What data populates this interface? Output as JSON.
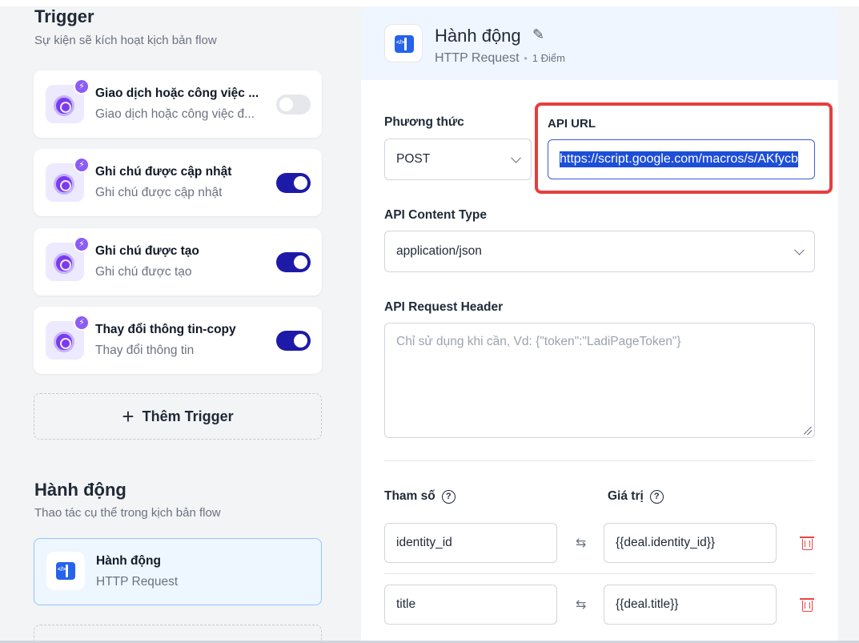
{
  "trigger_section": {
    "title": "Trigger",
    "subtitle": "Sự kiện sẽ kích hoạt kịch bản flow",
    "items": [
      {
        "title": "Giao dịch hoặc công việc ...",
        "subtitle": "Giao dịch hoặc công việc đ...",
        "enabled": false
      },
      {
        "title": "Ghi chú được cập nhật",
        "subtitle": "Ghi chú được cập nhật",
        "enabled": true
      },
      {
        "title": "Ghi chú được tạo",
        "subtitle": "Ghi chú được tạo",
        "enabled": true
      },
      {
        "title": "Thay đổi thông tin-copy",
        "subtitle": "Thay đổi thông tin",
        "enabled": true
      }
    ],
    "add_label": "Thêm Trigger"
  },
  "action_section": {
    "title": "Hành động",
    "subtitle": "Thao tác cụ thể trong kịch bản flow",
    "item": {
      "title": "Hành động",
      "subtitle": "HTTP Request"
    }
  },
  "panel": {
    "title": "Hành động",
    "type": "HTTP Request",
    "points": "1 Điểm",
    "method_label": "Phương thức",
    "method_value": "POST",
    "url_label": "API URL",
    "url_value": "https://script.google.com/macros/s/AKfycb",
    "content_type_label": "API Content Type",
    "content_type_value": "application/json",
    "header_label": "API Request Header",
    "header_placeholder": "Chỉ sử dụng khi cần, Vd: {\"token\":\"LadiPageToken\"}",
    "params_label": "Tham số",
    "values_label": "Giá trị",
    "params": [
      {
        "key": "identity_id",
        "value": "{{deal.identity_id}}"
      },
      {
        "key": "title",
        "value": "{{deal.title}}"
      }
    ]
  },
  "colors": {
    "accent": "#1e1aa8",
    "highlight_frame": "#e53e3e",
    "trigger_icon": "#7c3aed",
    "action_icon": "#2563eb",
    "delete": "#ef4444"
  }
}
